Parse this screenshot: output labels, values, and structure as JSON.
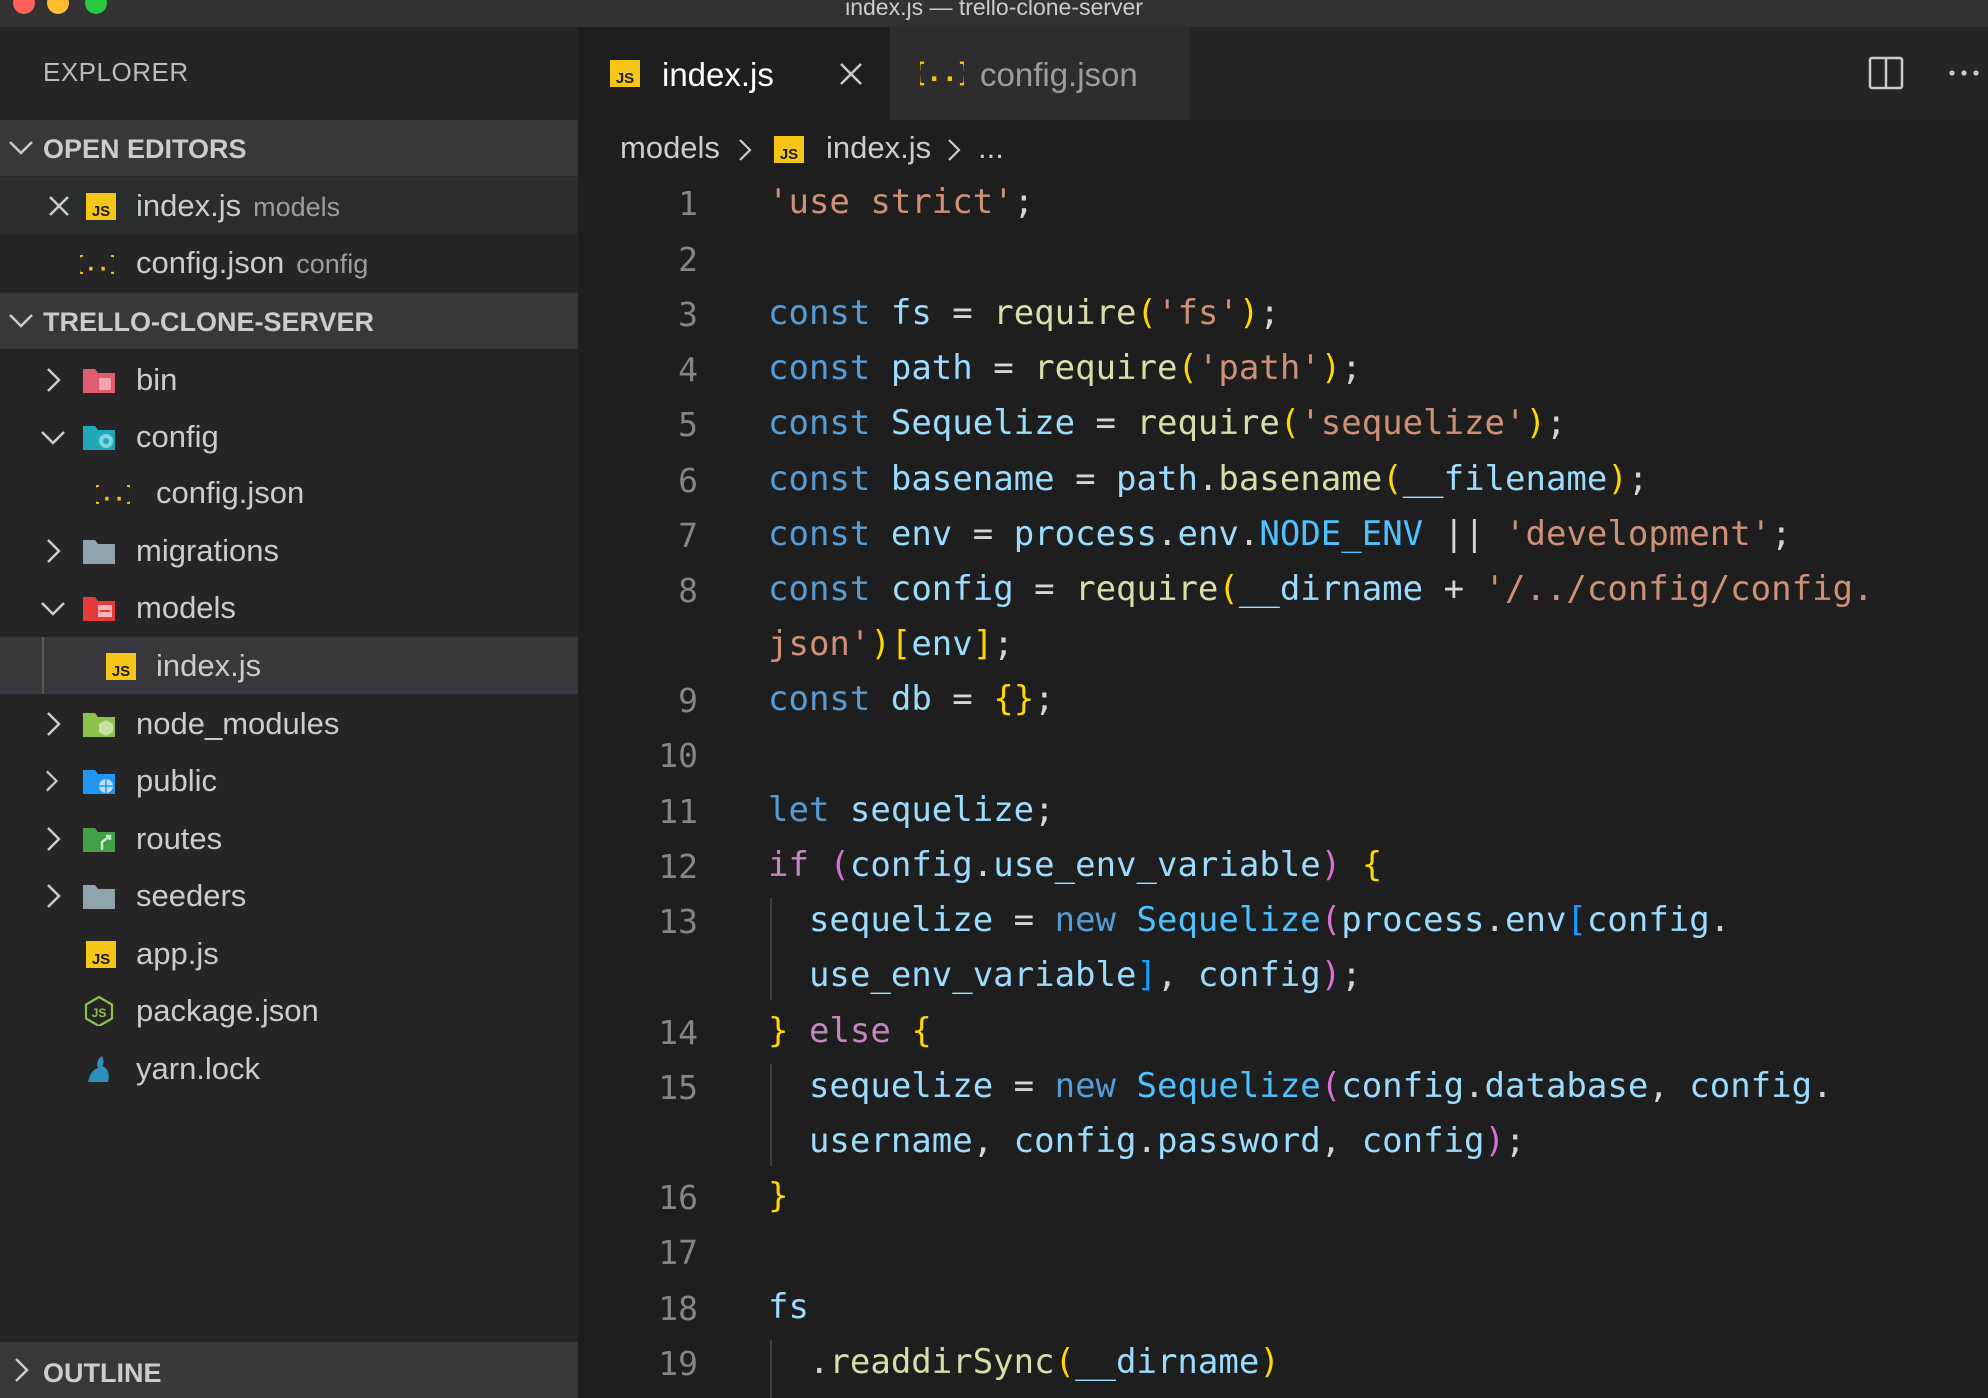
{
  "window": {
    "title": "index.js — trello-clone-server"
  },
  "sidebar": {
    "title": "EXPLORER",
    "open_editors": {
      "header": "OPEN EDITORS",
      "items": [
        {
          "name": "index.js",
          "desc": "models"
        },
        {
          "name": "config.json",
          "desc": "config"
        }
      ]
    },
    "project": {
      "header": "TRELLO-CLONE-SERVER",
      "items": [
        {
          "name": "bin"
        },
        {
          "name": "config"
        },
        {
          "name": "config.json"
        },
        {
          "name": "migrations"
        },
        {
          "name": "models"
        },
        {
          "name": "index.js"
        },
        {
          "name": "node_modules"
        },
        {
          "name": "public"
        },
        {
          "name": "routes"
        },
        {
          "name": "seeders"
        },
        {
          "name": "app.js"
        },
        {
          "name": "package.json"
        },
        {
          "name": "yarn.lock"
        }
      ]
    },
    "outline": {
      "header": "OUTLINE"
    }
  },
  "tabs": [
    {
      "label": "index.js"
    },
    {
      "label": "config.json"
    }
  ],
  "breadcrumb": {
    "folder": "models",
    "file": "index.js",
    "more": "..."
  },
  "editor": {
    "line_numbers": [
      "1",
      "2",
      "3",
      "4",
      "5",
      "6",
      "7",
      "8",
      "9",
      "10",
      "11",
      "12",
      "13",
      "14",
      "15",
      "16",
      "17",
      "18",
      "19"
    ]
  },
  "colors": {
    "background": "#1e1e1e",
    "sidebar": "#252526",
    "js_icon": "#f5c518",
    "keyword": "#569cd6",
    "string": "#ce9178",
    "function": "#dcdcaa",
    "variable": "#9cdcfe"
  }
}
